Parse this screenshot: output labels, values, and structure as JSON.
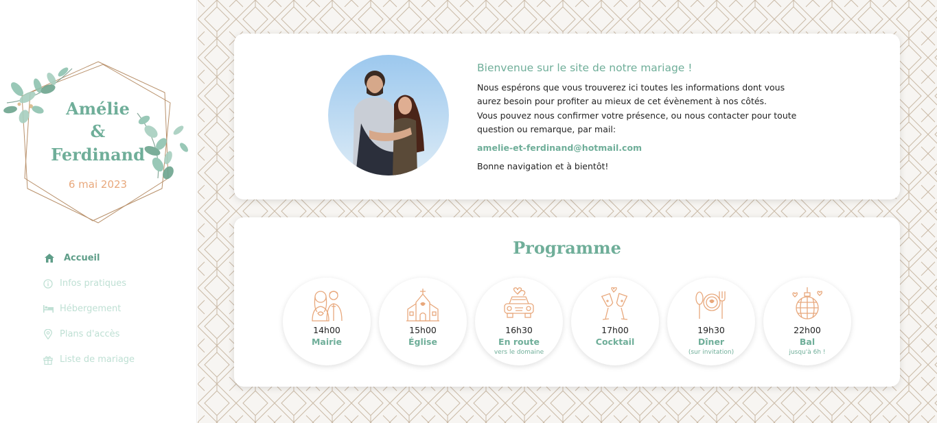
{
  "brand": {
    "name1": "Amélie",
    "amp": "&",
    "name2": "Ferdinand",
    "date": "6 mai 2023"
  },
  "nav": {
    "items": [
      {
        "label": "Accueil",
        "icon": "home-icon",
        "active": true
      },
      {
        "label": "Infos pratiques",
        "icon": "info-icon",
        "active": false
      },
      {
        "label": "Hébergement",
        "icon": "bed-icon",
        "active": false
      },
      {
        "label": "Plans d'accès",
        "icon": "map-pin-icon",
        "active": false
      },
      {
        "label": "Liste de mariage",
        "icon": "gift-icon",
        "active": false
      }
    ]
  },
  "welcome": {
    "title": "Bienvenue sur le site de notre mariage !",
    "line1": "Nous espérons que vous trouverez ici toutes les informations dont vous aurez besoin pour profiter au mieux de cet évènement à nos côtés.",
    "line2": "Vous pouvez nous confirmer votre présence, ou nous contacter pour toute question ou remarque, par mail:",
    "email": "amelie-et-ferdinand@hotmail.com",
    "closing": "Bonne navigation et à bientôt!"
  },
  "programme": {
    "title": "Programme",
    "events": [
      {
        "time": "14h00",
        "name": "Mairie",
        "sub": "",
        "icon": "couple-icon"
      },
      {
        "time": "15h00",
        "name": "Église",
        "sub": "",
        "icon": "church-icon"
      },
      {
        "time": "16h30",
        "name": "En route",
        "sub": "vers le domaine",
        "icon": "wedding-car-icon"
      },
      {
        "time": "17h00",
        "name": "Cocktail",
        "sub": "",
        "icon": "champagne-icon"
      },
      {
        "time": "19h30",
        "name": "Dîner",
        "sub": "(sur invitation)",
        "icon": "dinner-plate-icon"
      },
      {
        "time": "22h00",
        "name": "Bal",
        "sub": "jusqu'à 6h !",
        "icon": "disco-ball-icon"
      }
    ]
  },
  "colors": {
    "accent": "#6fae99",
    "peach": "#e8a87c",
    "gold": "#b8906a",
    "nav_inactive": "#bfe0d4"
  }
}
